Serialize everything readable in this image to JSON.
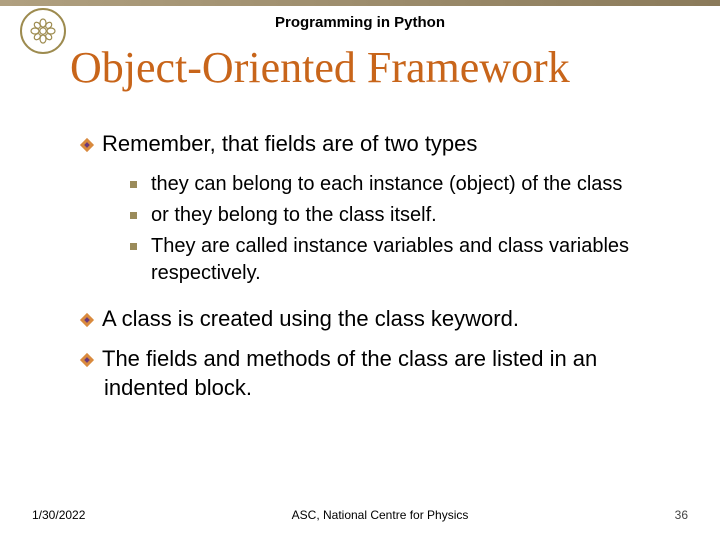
{
  "subtitle": "Programming in Python",
  "title": "Object-Oriented Framework",
  "bullets": {
    "b1": "Remember, that fields are of two types",
    "s1": "they can belong to each instance (object) of the class",
    "s2": "or they belong to the class itself.",
    "s3": "They are called instance variables and class variables respectively.",
    "b2": "A class is created using the class keyword.",
    "b3": "The fields and methods of the class are listed in an indented block."
  },
  "footer": {
    "date": "1/30/2022",
    "center": "ASC, National Centre for Physics",
    "page": "36"
  }
}
